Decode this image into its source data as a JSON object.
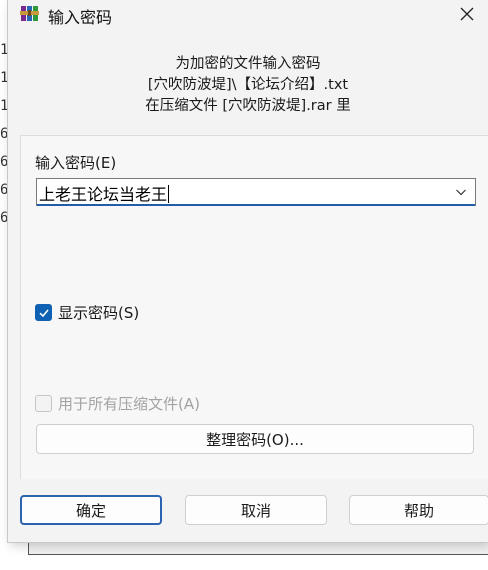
{
  "dialog": {
    "title": "输入密码",
    "info": {
      "line1": "为加密的文件输入密码",
      "line2": "[穴吹防波堤]\\【论坛介绍】.txt",
      "line3": "在压缩文件 [穴吹防波堤].rar 里"
    },
    "password": {
      "label": "输入密码(E)",
      "value": "上老王论坛当老王"
    },
    "show_password": {
      "label": "显示密码(S)",
      "checked": true
    },
    "use_for_all": {
      "label": "用于所有压缩文件(A)",
      "checked": false,
      "disabled": true
    },
    "organize_button": "整理密码(O)...",
    "buttons": {
      "ok": "确定",
      "cancel": "取消",
      "help": "帮助"
    }
  },
  "background": {
    "digits": [
      "1",
      "1",
      "1",
      "6",
      "6",
      "6",
      "6"
    ]
  },
  "colors": {
    "accent": "#0f62b3",
    "dialog_bg": "#f3f3f3"
  },
  "icons": {
    "app": "winrar-books-icon",
    "close": "close-icon",
    "dropdown": "chevron-down-icon",
    "check": "checkmark-icon"
  }
}
